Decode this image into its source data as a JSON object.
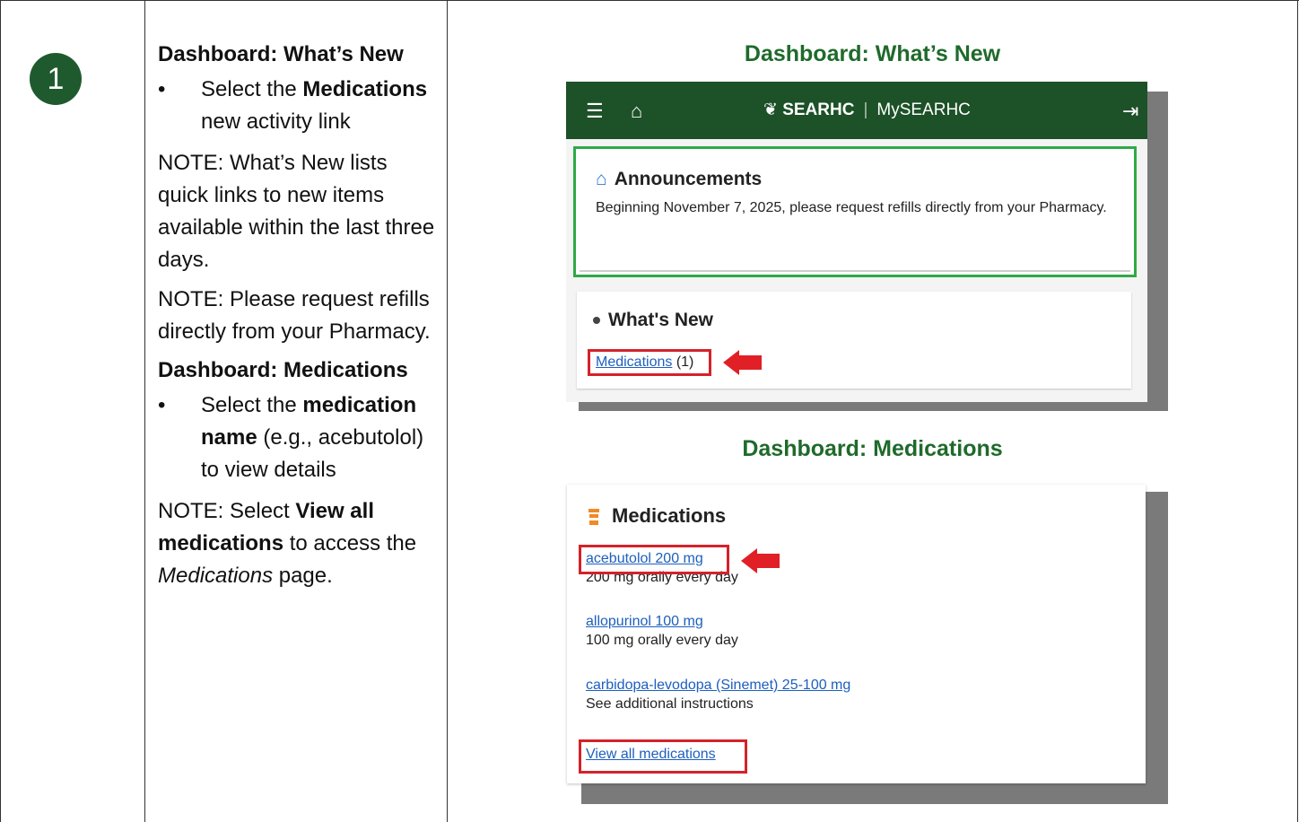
{
  "step_number": "1",
  "left": {
    "section1_heading": "Dashboard: What’s New",
    "bullet1_parts": [
      "Select the ",
      "Medications",
      " new activity link"
    ],
    "note1": "NOTE: What’s New lists quick links to new items available within the last three days.",
    "note2": "NOTE: Please request refills directly from your Pharmacy.",
    "section2_heading": "Dashboard: Medications",
    "bullet2_parts": [
      "Select the ",
      "medication name",
      " (e.g., acebutolol) to view details"
    ],
    "note3_parts": [
      "NOTE: Select ",
      "View all medications",
      " to access the ",
      "Medications",
      " page."
    ]
  },
  "right": {
    "title1": "Dashboard: What’s New",
    "title2": "Dashboard: Medications"
  },
  "app": {
    "brand_name": "SEARHC",
    "brand_product": "MySEARHC",
    "menu_icon": "hamburger-icon",
    "home_icon": "home-icon",
    "logout_icon": "logout-icon"
  },
  "announcements": {
    "title": "Announcements",
    "text": "Beginning November 7, 2025, please request refills directly from your Pharmacy."
  },
  "whats_new": {
    "title": "What's New",
    "link_label": "Medications",
    "count": "(1)"
  },
  "medications": {
    "title": "Medications",
    "items": [
      {
        "name": "acebutolol 200 mg",
        "sig": "200 mg orally every day"
      },
      {
        "name": "allopurinol 100 mg",
        "sig": "100 mg orally every day"
      },
      {
        "name": "carbidopa-levodopa (Sinemet) 25-100 mg",
        "sig": "See additional instructions"
      }
    ],
    "view_all": "View all medications"
  },
  "colors": {
    "step_circle": "#1f5a2e",
    "section_title": "#1f6a2b",
    "appbar": "#1d5128",
    "highlight_red": "#d4222a",
    "announcement_border": "#2eaa46",
    "link_blue": "#1d5fbf",
    "pill_orange": "#f08a24"
  }
}
